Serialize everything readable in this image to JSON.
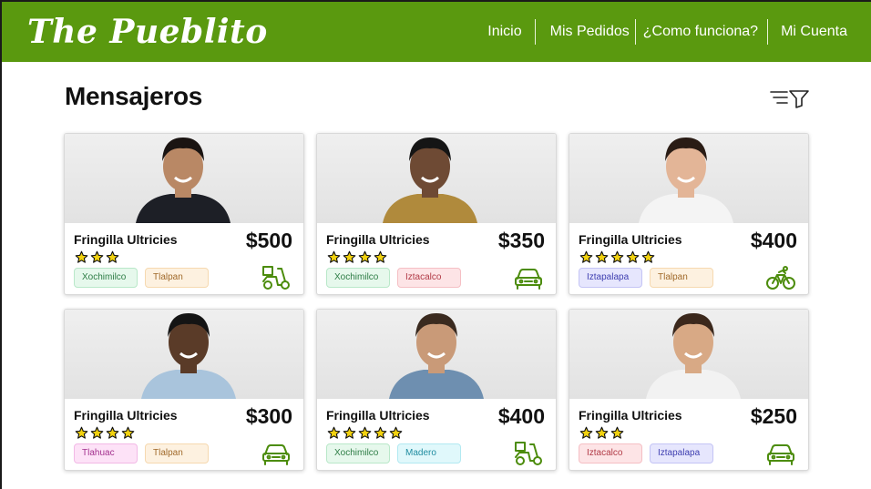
{
  "app": {
    "logo": "The Pueblito"
  },
  "nav": [
    {
      "label": "Inicio"
    },
    {
      "label": "Mis Pedidos"
    },
    {
      "label": "¿Como funciona?"
    },
    {
      "label": "Mi Cuenta"
    }
  ],
  "page": {
    "title": "Mensajeros",
    "filter_icon": "filter-list-icon"
  },
  "cards": [
    {
      "name": "Fringilla Ultricies",
      "price": "$500",
      "rating": 3,
      "vehicle": "scooter-icon",
      "tags": [
        {
          "label": "Xochimilco",
          "color": "green"
        },
        {
          "label": "Tlalpan",
          "color": "orange"
        }
      ]
    },
    {
      "name": "Fringilla Ultricies",
      "price": "$350",
      "rating": 4,
      "vehicle": "car-icon",
      "tags": [
        {
          "label": "Xochimilco",
          "color": "green"
        },
        {
          "label": "Iztacalco",
          "color": "red"
        }
      ]
    },
    {
      "name": "Fringilla Ultricies",
      "price": "$400",
      "rating": 5,
      "vehicle": "bicycle-icon",
      "tags": [
        {
          "label": "Iztapalapa",
          "color": "purple"
        },
        {
          "label": "Tlalpan",
          "color": "orange"
        }
      ]
    },
    {
      "name": "Fringilla Ultricies",
      "price": "$300",
      "rating": 4,
      "vehicle": "car-icon",
      "tags": [
        {
          "label": "Tlahuac",
          "color": "pink"
        },
        {
          "label": "Tlalpan",
          "color": "orange"
        }
      ]
    },
    {
      "name": "Fringilla Ultricies",
      "price": "$400",
      "rating": 5,
      "vehicle": "scooter-icon",
      "tags": [
        {
          "label": "Xochimilco",
          "color": "green"
        },
        {
          "label": "Madero",
          "color": "cyan"
        }
      ]
    },
    {
      "name": "Fringilla Ultricies",
      "price": "$250",
      "rating": 3,
      "vehicle": "car-icon",
      "tags": [
        {
          "label": "Iztacalco",
          "color": "red"
        },
        {
          "label": "Iztapalapa",
          "color": "purple"
        }
      ]
    }
  ],
  "colors": {
    "brand": "#5a990f",
    "icon_green": "#4c8c0c",
    "star": "#f2d20f",
    "tag_green": {
      "bg": "#e6f8ec",
      "border": "#b9e8c9",
      "text": "#2e7d46"
    },
    "tag_orange": {
      "bg": "#fdf1e0",
      "border": "#f6d9b0",
      "text": "#a0692a"
    },
    "tag_red": {
      "bg": "#fde4e6",
      "border": "#f5bfc4",
      "text": "#b13a46"
    },
    "tag_purple": {
      "bg": "#e6e6fd",
      "border": "#c4c4f5",
      "text": "#3f3fb0"
    },
    "tag_pink": {
      "bg": "#fde2f7",
      "border": "#f2b9e6",
      "text": "#a3318e"
    },
    "tag_cyan": {
      "bg": "#e0f8fb",
      "border": "#b2e9f1",
      "text": "#1f8ca0"
    }
  }
}
